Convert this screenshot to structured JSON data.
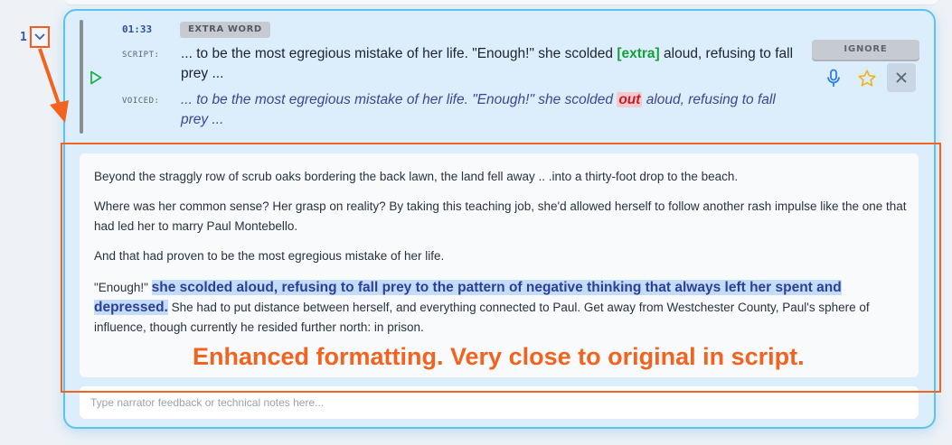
{
  "row": {
    "number": "1"
  },
  "issue": {
    "timestamp": "01:33",
    "badge": "EXTRA WORD",
    "script_label": "SCRIPT:",
    "voiced_label": "VOICED:",
    "script_before": "... to be the most egregious mistake of her life. \"Enough!\" she scolded ",
    "script_tag": "[extra]",
    "script_after": " aloud, refusing to fall prey ...",
    "voiced_before": "... to be the most egregious mistake of her life. \"Enough!\" she scolded ",
    "voiced_tag": "out",
    "voiced_after": " aloud, refusing to fall prey ..."
  },
  "actions": {
    "ignore_label": "IGNORE",
    "mic_icon": "microphone-icon",
    "star_icon": "star-icon",
    "close_icon": "close-icon"
  },
  "context": {
    "p1": "Beyond the straggly row of scrub oaks bordering the back lawn, the land fell away .. .into a thirty-foot drop to the beach.",
    "p2": "Where was her common sense? Her grasp on reality? By taking this teaching job, she'd allowed herself to follow another rash impulse like the one that had led her to marry Paul Montebello.",
    "p3": "And that had proven to be the most egregious mistake of her life.",
    "p4_before": "\"Enough!\" ",
    "p4_highlight": "she scolded aloud, refusing to fall prey to the pattern of negative thinking that always left her spent and depressed.",
    "p4_after": " She had to put distance between herself, and everything connected to Paul. Get away from Westchester County, Paul's sphere of influence, though currently he resided further north: in prison."
  },
  "feedback": {
    "placeholder": "Type narrator feedback or technical notes here..."
  },
  "annotation": {
    "text": "Enhanced formatting. Very close to original in script."
  },
  "colors": {
    "accent_orange": "#f2631f",
    "card_border": "#5ec3e8",
    "extra_green": "#15a03a",
    "out_red": "#c21f2b",
    "highlight": "#c5dcf8"
  }
}
